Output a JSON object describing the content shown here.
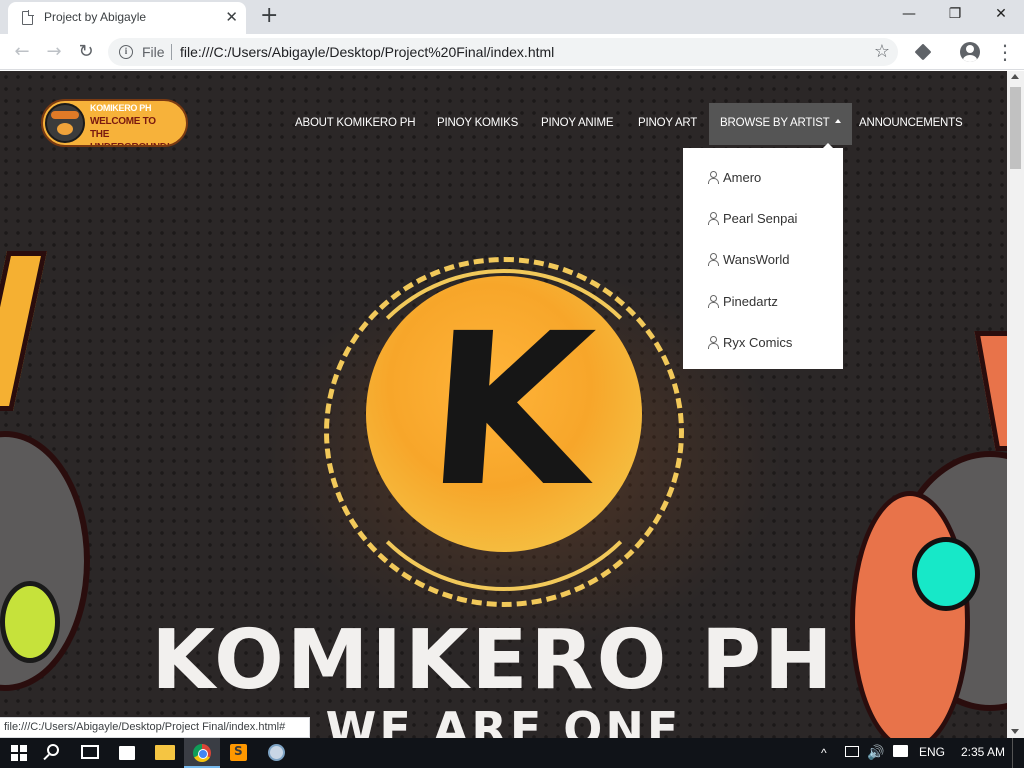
{
  "browser": {
    "tab_title": "Project by Abigayle",
    "tab_close": "✕",
    "new_tab": "+",
    "scheme_label": "File",
    "url": "file:///C:/Users/Abigayle/Desktop/Project%20Final/index.html",
    "status_url": "file:///C:/Users/Abigayle/Desktop/Project Final/index.html#",
    "window_controls": {
      "minimize": "—",
      "maximize": "❐",
      "close": "✕"
    },
    "icons": {
      "back": "arrow-left-icon",
      "forward": "arrow-right-icon",
      "reload": "reload-icon",
      "info": "info-icon",
      "bookmark": "star-icon",
      "extension": "extension-icon",
      "profile": "profile-icon",
      "menu": "kebab-menu-icon"
    }
  },
  "site": {
    "logo": {
      "line1": "KOMIKERO PH",
      "line2": "WELCOME TO",
      "line3": "THE UNDERGROUND!"
    },
    "nav": [
      {
        "label": "ABOUT KOMIKERO PH"
      },
      {
        "label": "PINOY KOMIKS"
      },
      {
        "label": "PINOY ANIME"
      },
      {
        "label": "PINOY ART"
      },
      {
        "label": "BROWSE BY ARTIST",
        "active": true
      },
      {
        "label": "ANNOUNCEMENTS"
      }
    ],
    "dropdown": [
      {
        "label": "Amero",
        "icon": "person-icon"
      },
      {
        "label": "Pearl Senpai",
        "icon": "person-icon"
      },
      {
        "label": "WansWorld",
        "icon": "person-icon"
      },
      {
        "label": "Pinedartz",
        "icon": "person-icon"
      },
      {
        "label": "Ryx Comics",
        "icon": "person-icon"
      }
    ],
    "hero": {
      "letter": "K",
      "title": "KOMIKERO PH",
      "tagline": "WE ARE ONE"
    },
    "colors": {
      "accent": "#f7a62a",
      "nav_active_bg": "#555555",
      "background": "#2b2727"
    }
  },
  "taskbar": {
    "apps": [
      "start-icon",
      "search-icon",
      "task-view-icon",
      "store-icon",
      "file-explorer-icon",
      "chrome-icon",
      "sublime-text-icon",
      "paint-icon"
    ],
    "tray": {
      "chevron": "^",
      "volume": "🔊",
      "language": "ENG",
      "time": "2:35 AM"
    }
  }
}
